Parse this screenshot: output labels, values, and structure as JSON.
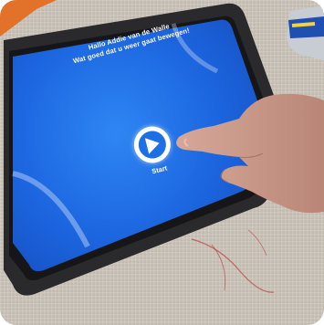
{
  "screen": {
    "greeting_line1": "Hallo Addie van de Walle",
    "greeting_line2": "Wat goed dat u weer gaat bewegen!",
    "start_label": "Start"
  },
  "icons": {
    "play": "play-icon"
  },
  "colors": {
    "screen_blue": "#1e6fe6",
    "tablet_case": "#2a2a2c",
    "tablecloth": "#cfc8bd"
  }
}
